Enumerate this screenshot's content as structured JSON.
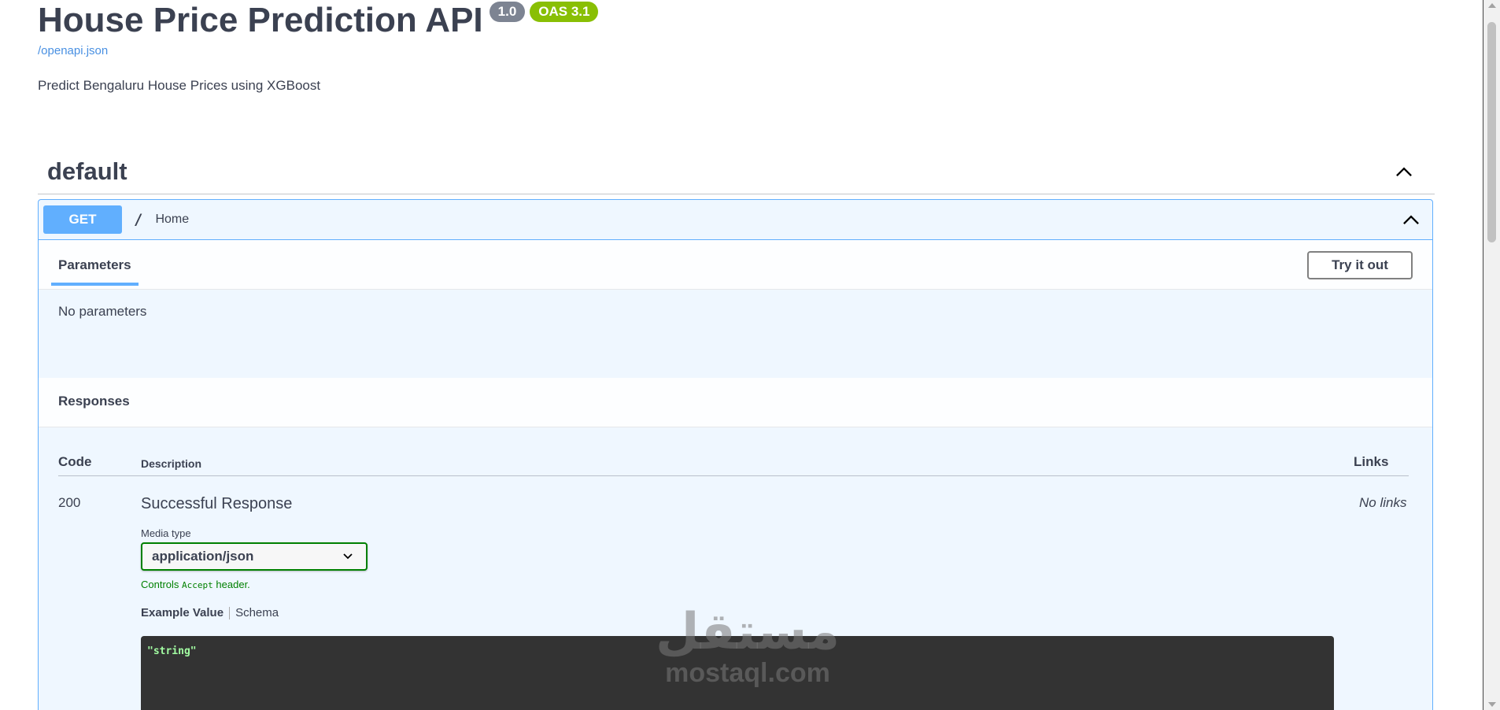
{
  "info": {
    "title": "House Price Prediction API",
    "version": "1.0",
    "oas": "OAS 3.1",
    "spec_link": "/openapi.json",
    "description": "Predict Bengaluru House Prices using XGBoost"
  },
  "tag": {
    "name": "default"
  },
  "operation": {
    "method": "GET",
    "path": "/",
    "summary": "Home",
    "tab_label": "Parameters",
    "try_button": "Try it out",
    "no_params": "No parameters"
  },
  "responses": {
    "title": "Responses",
    "col_code": "Code",
    "col_description": "Description",
    "col_links": "Links",
    "rows": [
      {
        "code": "200",
        "description": "Successful Response",
        "links": "No links",
        "media_label": "Media type",
        "media_value": "application/json",
        "controls_prefix": "Controls",
        "controls_code": "Accept",
        "controls_suffix": "header.",
        "example_tab": "Example Value",
        "schema_tab": "Schema",
        "example_code": "\"string\""
      }
    ]
  },
  "watermark": {
    "arabic": "مستقل",
    "latin": "mostaql.com"
  },
  "colors": {
    "get": "#61affe",
    "oas": "#89bf04",
    "version": "#7d8492",
    "link": "#4990e2",
    "success": "#008000"
  }
}
